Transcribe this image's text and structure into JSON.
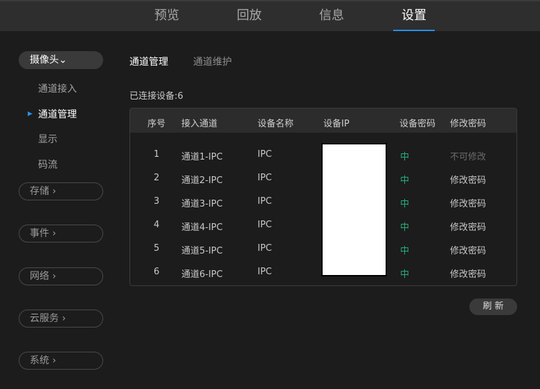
{
  "top_tabs": [
    {
      "label": "预览",
      "active": false
    },
    {
      "label": "回放",
      "active": false
    },
    {
      "label": "信息",
      "active": false
    },
    {
      "label": "设置",
      "active": true
    }
  ],
  "sidebar": {
    "camera_group": "摄像头",
    "camera_items": [
      "通道接入",
      "通道管理",
      "显示",
      "码流"
    ],
    "active_item": "通道管理",
    "groups": [
      "存储",
      "事件",
      "网络",
      "云服务",
      "系统"
    ]
  },
  "sub_tabs": [
    {
      "label": "通道管理",
      "active": true
    },
    {
      "label": "通道维护",
      "active": false
    }
  ],
  "connected_label": "已连接设备:6",
  "table": {
    "headers": [
      "序号",
      "接入通道",
      "设备名称",
      "设备IP",
      "设备密码",
      "修改密码"
    ],
    "rows": [
      {
        "index": "1",
        "channel": "通道1-IPC",
        "name": "IPC",
        "password": "中",
        "action": "不可修改",
        "action_enabled": false
      },
      {
        "index": "2",
        "channel": "通道2-IPC",
        "name": "IPC",
        "password": "中",
        "action": "修改密码",
        "action_enabled": true
      },
      {
        "index": "3",
        "channel": "通道3-IPC",
        "name": "IPC",
        "password": "中",
        "action": "修改密码",
        "action_enabled": true
      },
      {
        "index": "4",
        "channel": "通道4-IPC",
        "name": "IPC",
        "password": "中",
        "action": "修改密码",
        "action_enabled": true
      },
      {
        "index": "5",
        "channel": "通道5-IPC",
        "name": "IPC",
        "password": "中",
        "action": "修改密码",
        "action_enabled": true
      },
      {
        "index": "6",
        "channel": "通道6-IPC",
        "name": "IPC",
        "password": "中",
        "action": "修改密码",
        "action_enabled": true
      }
    ]
  },
  "refresh_label": "刷 新",
  "colors": {
    "accent": "#2b8ee8",
    "password_strength": "#23b07a",
    "background": "#1c1c1c",
    "header_bar": "#2e2e2e"
  }
}
